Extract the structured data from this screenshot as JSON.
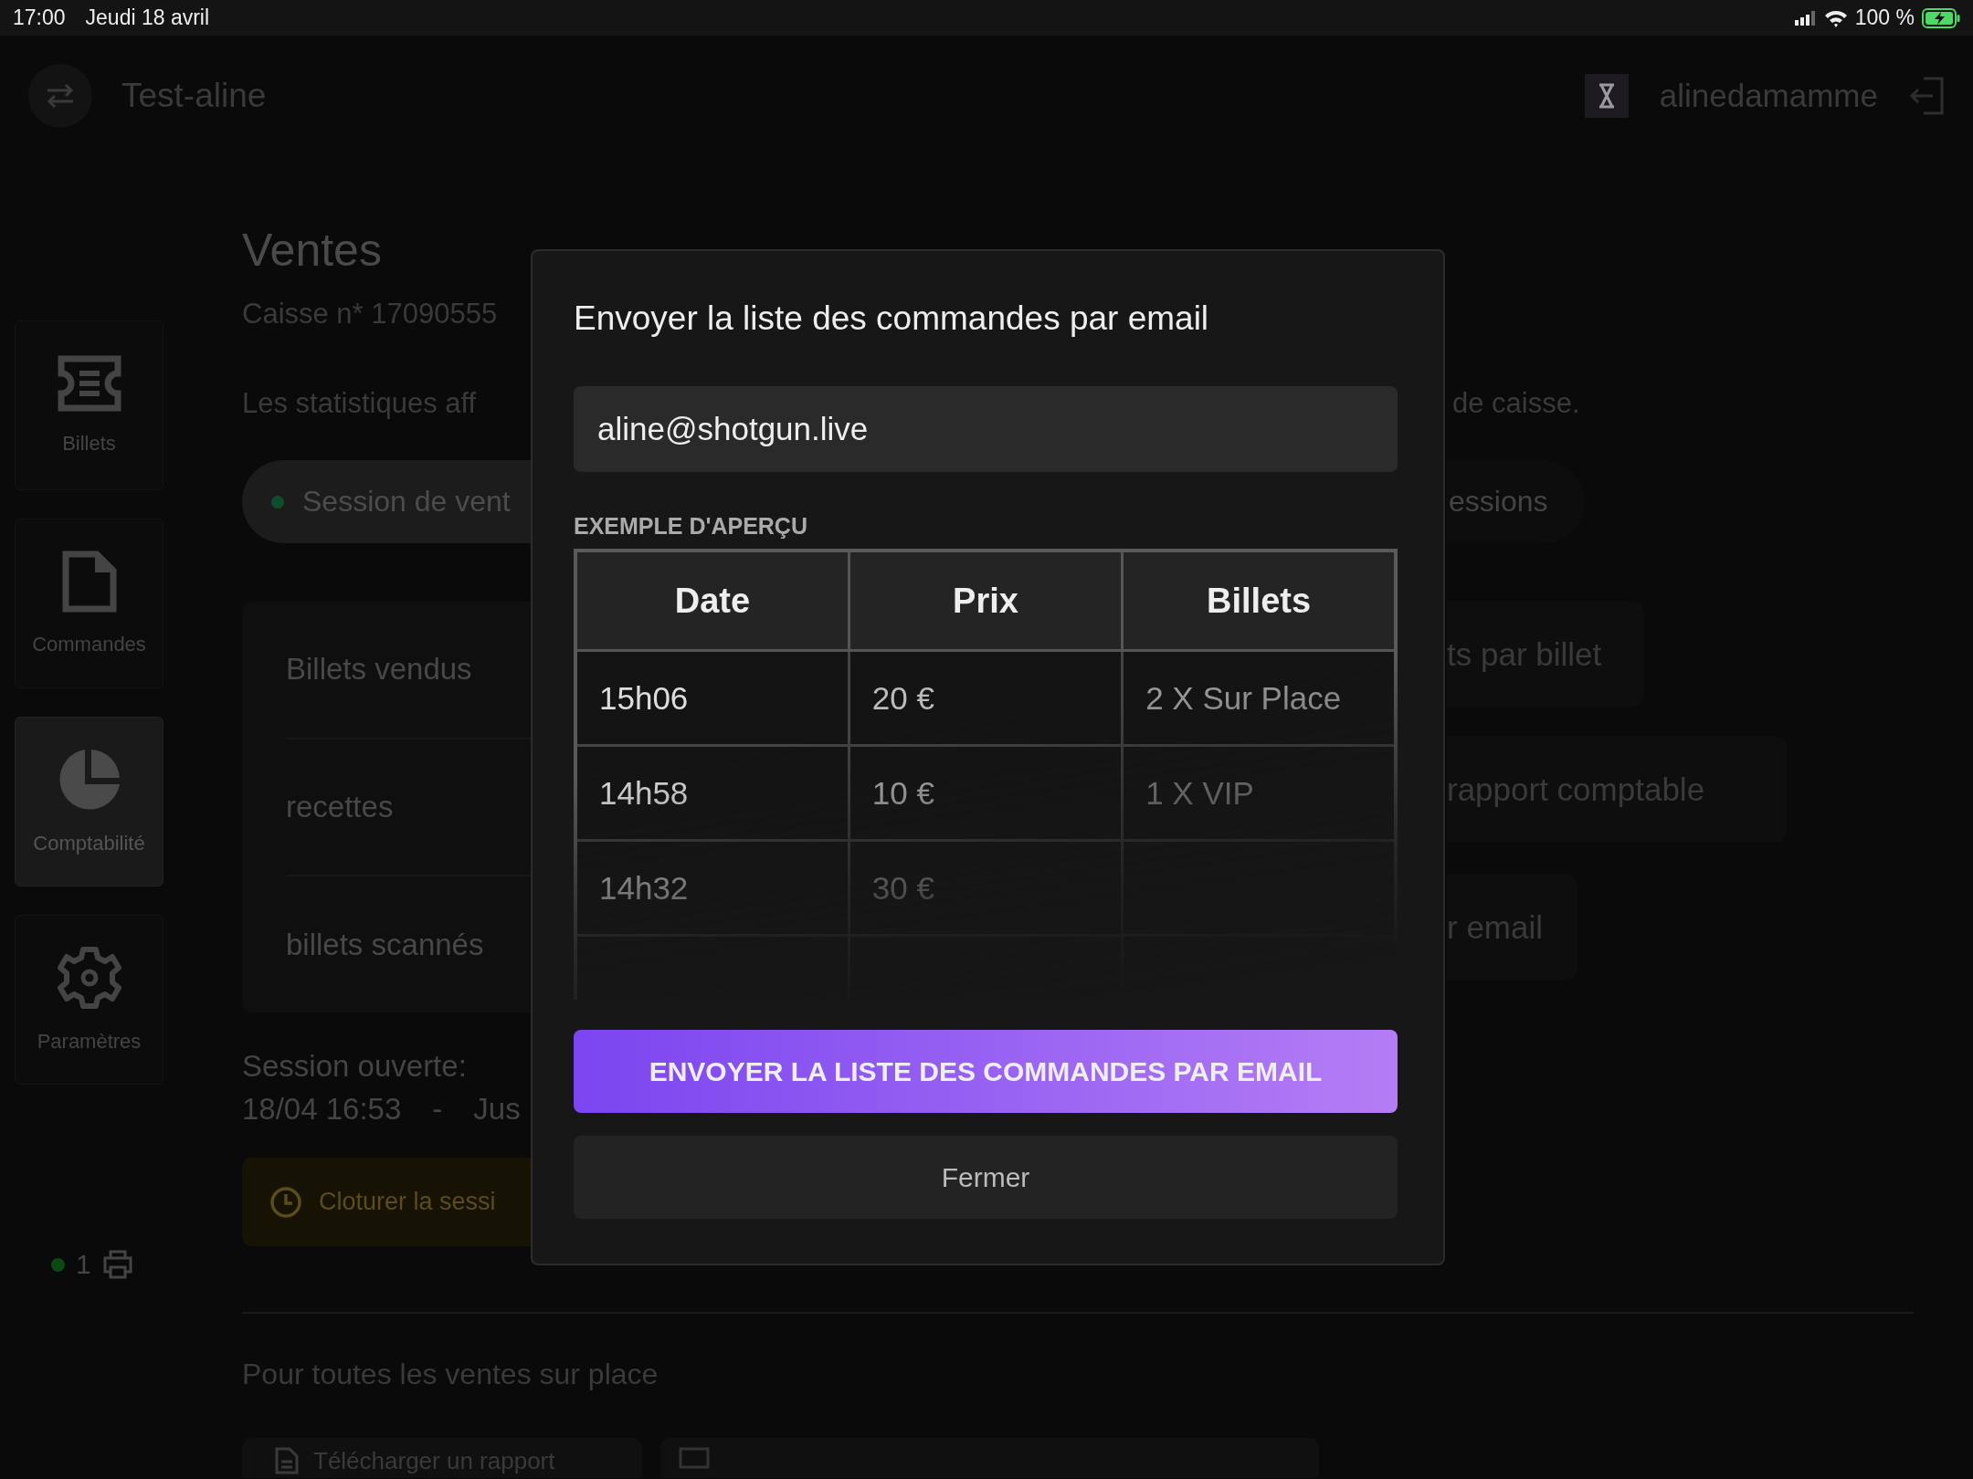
{
  "status_bar": {
    "time": "17:00",
    "date": "Jeudi 18 avril",
    "battery": "100 %"
  },
  "header": {
    "title": "Test-aline",
    "username": "alinedamamme"
  },
  "sidebar": {
    "items": [
      {
        "label": "Billets",
        "kind": "ticket",
        "selected": false
      },
      {
        "label": "Commandes",
        "kind": "document",
        "selected": false
      },
      {
        "label": "Comptabilité",
        "kind": "chart",
        "selected": true
      },
      {
        "label": "Paramètres",
        "kind": "settings",
        "selected": false
      }
    ],
    "printer_count": "1"
  },
  "page": {
    "title": "Ventes",
    "register": "Caisse n* 17090555",
    "note": {
      "start": "Les statistiques aff",
      "end": "de caisse."
    },
    "session_tabs": [
      {
        "label": "Session de vent",
        "selected": true
      },
      {
        "label": "essions",
        "selected": false
      }
    ],
    "stats": [
      "Billets vendus",
      "recettes",
      "billets scannés"
    ],
    "actions": [
      "ts par billet",
      "rapport comptable",
      "r email"
    ],
    "session_opened": {
      "label": "Session ouverte:",
      "start": "18/04 16:53",
      "separator": "-",
      "end": "Jus"
    },
    "close_session": "Cloturer la sessi",
    "section_title": "Pour toutes les ventes sur place",
    "report_button": "Télécharger un rapport"
  },
  "dialog": {
    "title": "Envoyer la liste des commandes par email",
    "email": "aline@shotgun.live",
    "preview_label": "EXEMPLE D'APERÇU",
    "table": {
      "columns": [
        "Date",
        "Prix",
        "Billets"
      ],
      "rows": [
        [
          "15h06",
          "20 €",
          "2 X Sur Place"
        ],
        [
          "14h58",
          "10 €",
          "1 X VIP"
        ],
        [
          "14h32",
          "30 €"
        ]
      ]
    },
    "buttons": [
      {
        "label": "ENVOYER LA LISTE DES COMMANDES PAR EMAIL",
        "kind": "primary"
      },
      {
        "label": "Fermer",
        "kind": "secondary"
      }
    ]
  }
}
